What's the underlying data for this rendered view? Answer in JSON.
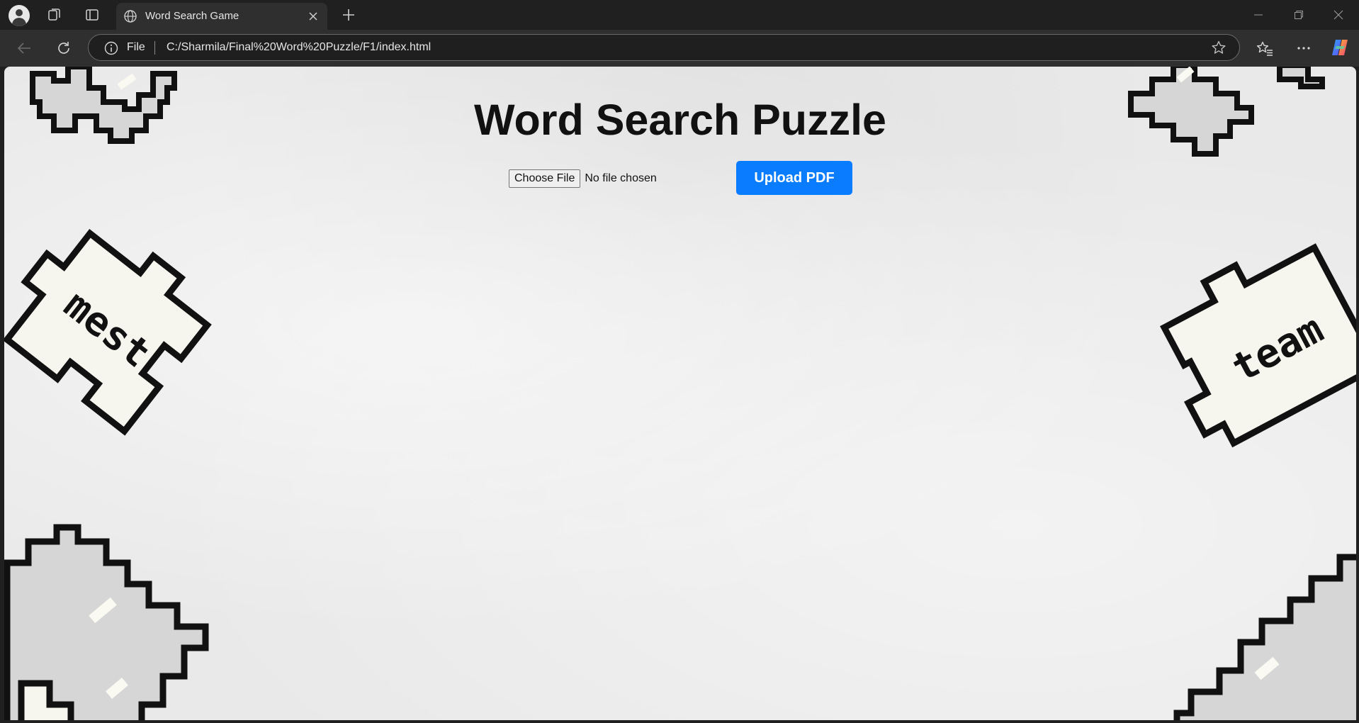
{
  "browser": {
    "tab": {
      "title": "Word Search Game"
    },
    "address_bar": {
      "scheme_label": "File",
      "url": "C:/Sharmila/Final%20Word%20Puzzle/F1/index.html"
    }
  },
  "page": {
    "heading": "Word Search Puzzle",
    "file_input": {
      "button_label": "Choose File",
      "status": "No file chosen"
    },
    "upload_button": "Upload PDF",
    "decorations": {
      "left_piece_text": "mest",
      "right_piece_text": "team"
    },
    "colors": {
      "upload_button": "#0a7cff",
      "page_background": "#e9e9e9",
      "puzzle_piece_fill": "#f6f5ee",
      "puzzle_piece_outline": "#111111"
    }
  }
}
